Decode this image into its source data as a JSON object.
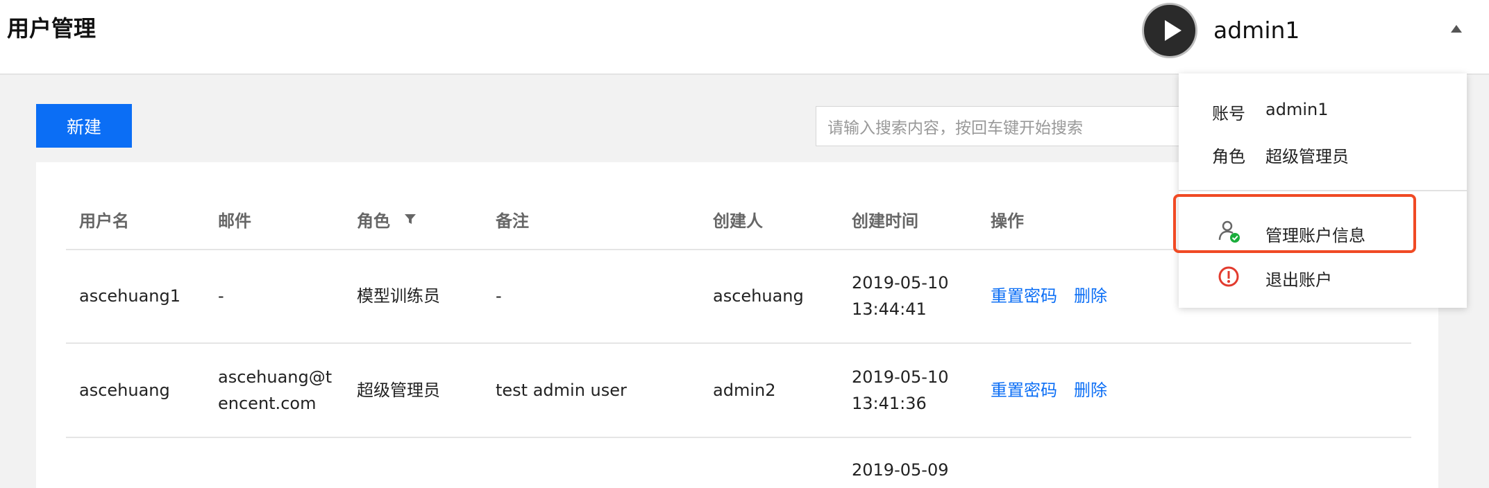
{
  "header": {
    "title": "用户管理",
    "user_name": "admin1",
    "avatar_icon": "play-icon"
  },
  "toolbar": {
    "new_label": "新建",
    "search_placeholder": "请输入搜索内容，按回车键开始搜索",
    "accent_color": "#0b6ef5"
  },
  "table": {
    "columns": [
      "用户名",
      "邮件",
      "角色",
      "备注",
      "创建人",
      "创建时间",
      "操作"
    ],
    "role_filter_icon": "filter-icon",
    "rows": [
      {
        "username": "ascehuang1",
        "email": [
          "-",
          ""
        ],
        "role": "模型训练员",
        "note": "-",
        "creator": "ascehuang",
        "created_date": "2019-05-10",
        "created_time": "13:44:41",
        "reset_label": "重置密码",
        "delete_label": "删除"
      },
      {
        "username": "ascehuang",
        "email": [
          "ascehuang@t",
          "encent.com"
        ],
        "role": "超级管理员",
        "note": "test admin user",
        "creator": "admin2",
        "created_date": "2019-05-10",
        "created_time": "13:41:36",
        "reset_label": "重置密码",
        "delete_label": "删除"
      },
      {
        "created_date": "2019-05-09"
      }
    ]
  },
  "dropdown": {
    "account_label": "账号",
    "account_value": "admin1",
    "role_label": "角色",
    "role_value": "超级管理员",
    "manage_label": "管理账户信息",
    "manage_icon": "user-check-icon",
    "logout_label": "退出账户",
    "logout_icon": "alert-circle-icon",
    "highlight_color": "#f04a24"
  }
}
